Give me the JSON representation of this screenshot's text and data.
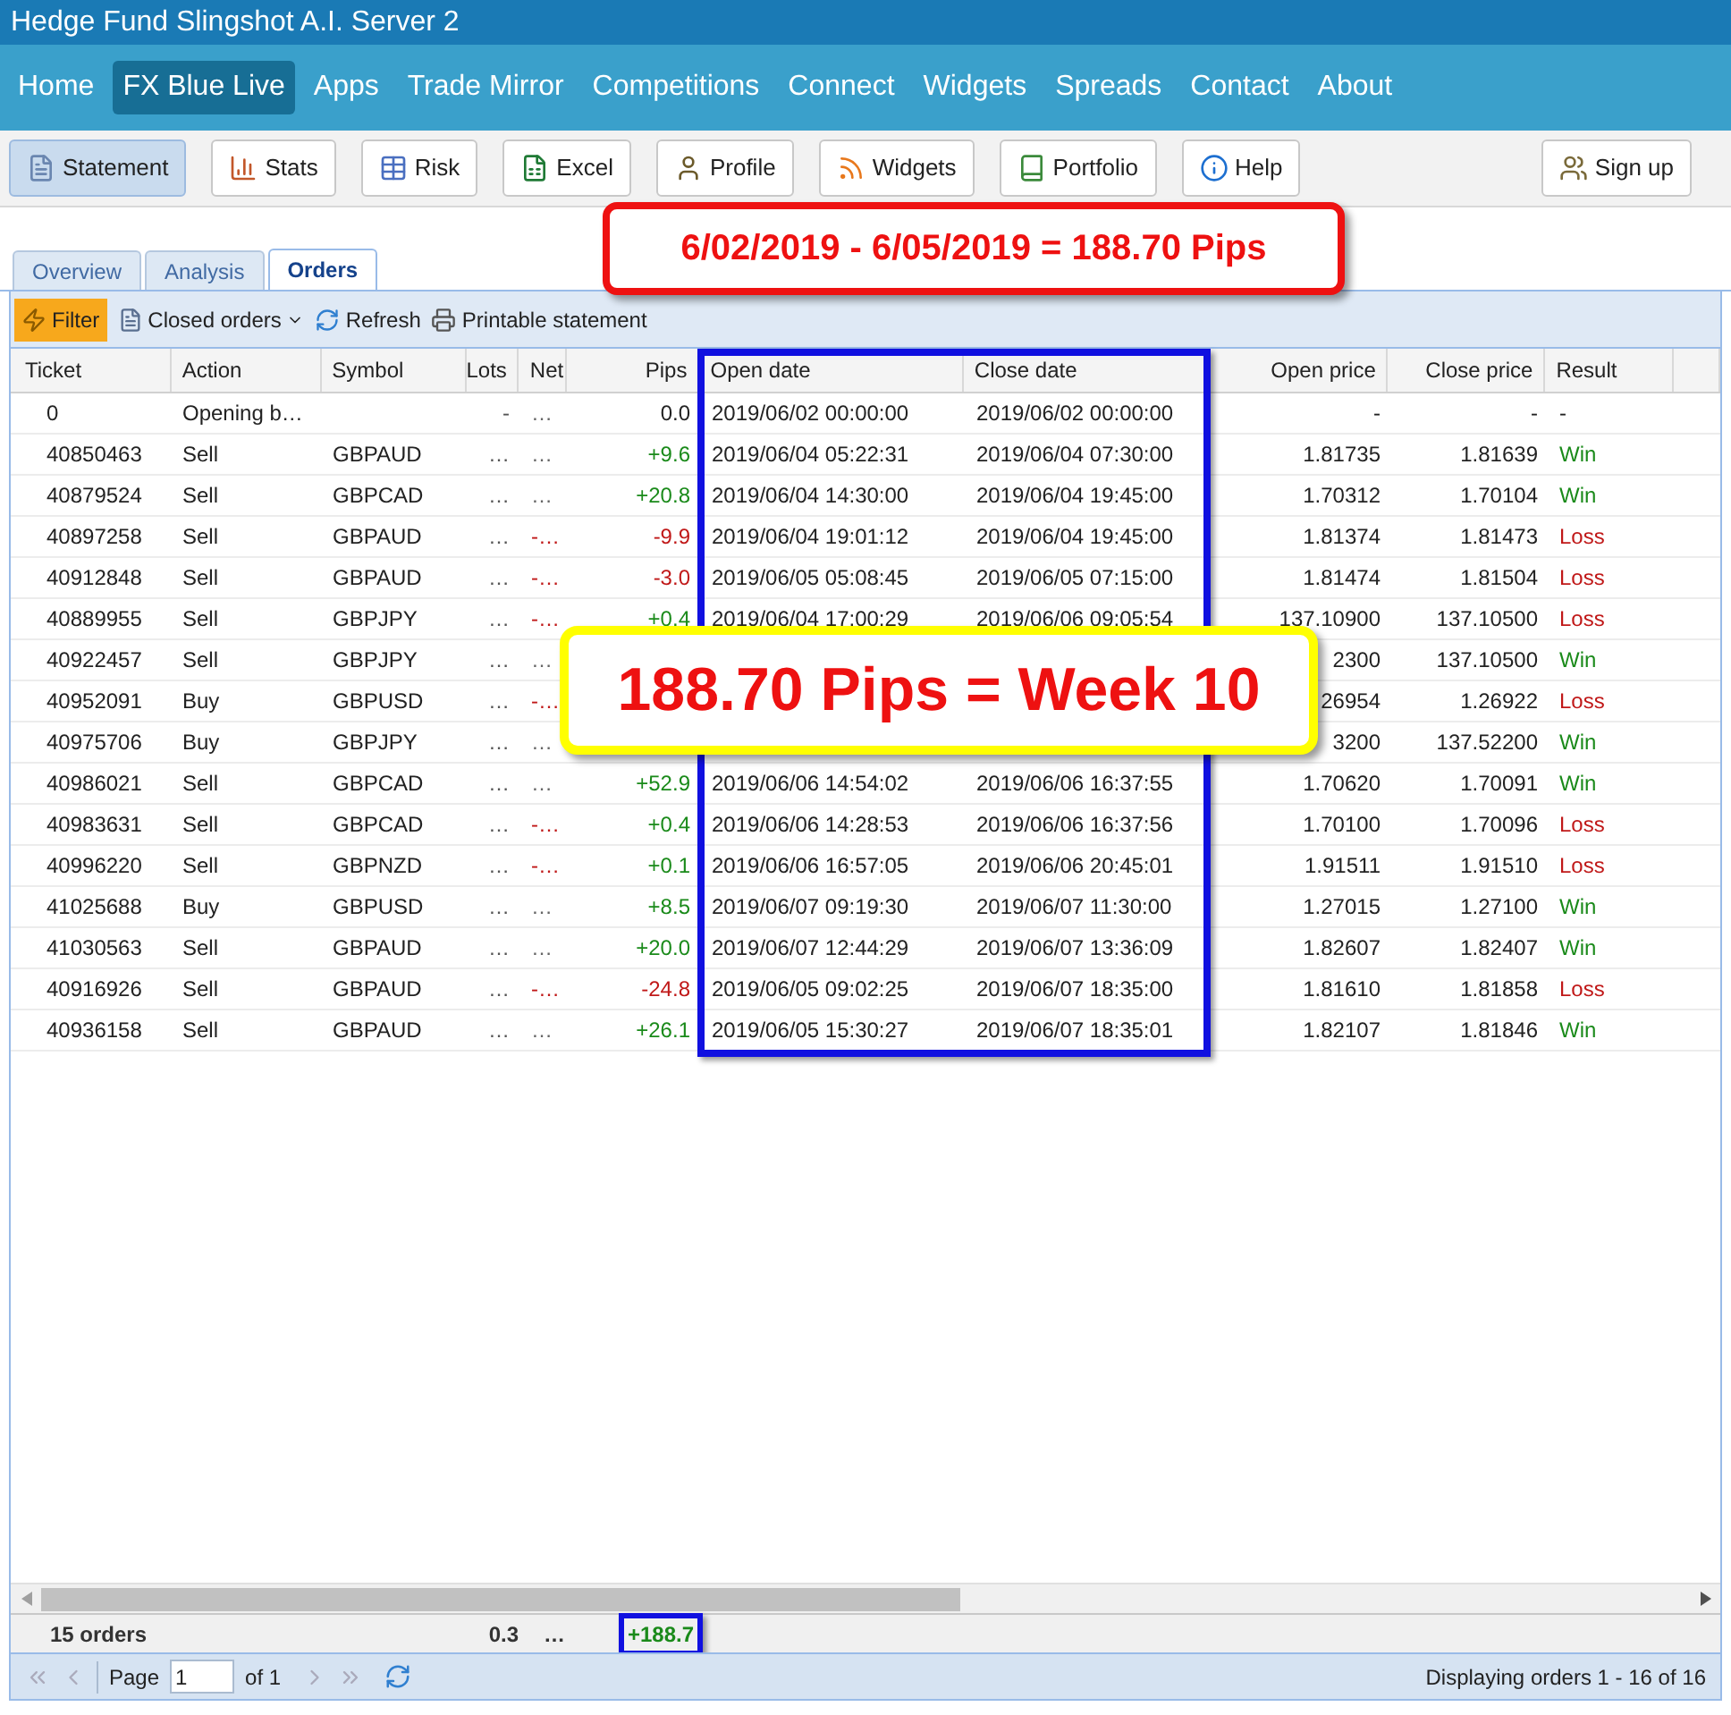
{
  "window": {
    "title": "Hedge Fund Slingshot A.I. Server 2"
  },
  "nav": [
    {
      "label": "Home",
      "selected": false
    },
    {
      "label": "FX Blue Live",
      "selected": true
    },
    {
      "label": "Apps",
      "selected": false
    },
    {
      "label": "Trade Mirror",
      "selected": false
    },
    {
      "label": "Competitions",
      "selected": false
    },
    {
      "label": "Connect",
      "selected": false
    },
    {
      "label": "Widgets",
      "selected": false
    },
    {
      "label": "Spreads",
      "selected": false
    },
    {
      "label": "Contact",
      "selected": false
    },
    {
      "label": "About",
      "selected": false
    }
  ],
  "toolbar": [
    {
      "label": "Statement",
      "selected": true
    },
    {
      "label": "Stats",
      "selected": false
    },
    {
      "label": "Risk",
      "selected": false
    },
    {
      "label": "Excel",
      "selected": false
    },
    {
      "label": "Profile",
      "selected": false
    },
    {
      "label": "Widgets",
      "selected": false
    },
    {
      "label": "Portfolio",
      "selected": false
    },
    {
      "label": "Help",
      "selected": false
    }
  ],
  "sign_up": "Sign up",
  "top_callout": {
    "text": "6/02/2019 - 6/05/2019 = 188.70 Pips"
  },
  "tabs": [
    {
      "label": "Overview",
      "selected": false
    },
    {
      "label": "Analysis",
      "selected": false
    },
    {
      "label": "Orders",
      "selected": true
    }
  ],
  "grid_toolbar": {
    "filter": "Filter",
    "closed_orders": "Closed orders",
    "refresh": "Refresh",
    "printable": "Printable statement"
  },
  "table": {
    "columns": [
      "Ticket",
      "Action",
      "Symbol",
      "Lots",
      "Net",
      "Pips",
      "Open date",
      "Close date",
      "Open price",
      "Close price",
      "Result"
    ],
    "rows": [
      {
        "kind": "opening",
        "ticket": "0",
        "action": "Opening b…",
        "lots": "-",
        "net": "…",
        "net_negative": false,
        "pips": "0.0",
        "open_date": "2019/06/02 00:00:00",
        "close_date": "2019/06/02 00:00:00",
        "open_price": "-",
        "close_price": "-",
        "result": "-"
      },
      {
        "kind": "trade",
        "ticket": "40850463",
        "action": "Sell",
        "symbol": "GBPAUD",
        "lots": "…",
        "net": "…",
        "net_negative": false,
        "pips": "+9.6",
        "gain": true,
        "open_date": "2019/06/04 05:22:31",
        "close_date": "2019/06/04 07:30:00",
        "open_price": "1.81735",
        "close_price": "1.81639",
        "result": "Win",
        "won": true
      },
      {
        "kind": "trade",
        "ticket": "40879524",
        "action": "Sell",
        "symbol": "GBPCAD",
        "lots": "…",
        "net": "…",
        "net_negative": false,
        "pips": "+20.8",
        "gain": true,
        "open_date": "2019/06/04 14:30:00",
        "close_date": "2019/06/04 19:45:00",
        "open_price": "1.70312",
        "close_price": "1.70104",
        "result": "Win",
        "won": true
      },
      {
        "kind": "trade",
        "ticket": "40897258",
        "action": "Sell",
        "symbol": "GBPAUD",
        "lots": "…",
        "net": "-…",
        "net_negative": true,
        "pips": "-9.9",
        "gain": false,
        "open_date": "2019/06/04 19:01:12",
        "close_date": "2019/06/04 19:45:00",
        "open_price": "1.81374",
        "close_price": "1.81473",
        "result": "Loss",
        "won": false
      },
      {
        "kind": "trade",
        "ticket": "40912848",
        "action": "Sell",
        "symbol": "GBPAUD",
        "lots": "…",
        "net": "-…",
        "net_negative": true,
        "pips": "-3.0",
        "gain": false,
        "open_date": "2019/06/05 05:08:45",
        "close_date": "2019/06/05 07:15:00",
        "open_price": "1.81474",
        "close_price": "1.81504",
        "result": "Loss",
        "won": false
      },
      {
        "kind": "trade",
        "ticket": "40889955",
        "action": "Sell",
        "symbol": "GBPJPY",
        "lots": "…",
        "net": "-…",
        "net_negative": true,
        "pips": "+0.4",
        "gain": true,
        "open_date": "2019/06/04 17:00:29",
        "close_date": "2019/06/06 09:05:54",
        "open_price": "137.10900",
        "close_price": "137.10500",
        "result": "Loss",
        "won": false
      },
      {
        "kind": "trade",
        "ticket": "40922457",
        "action": "Sell",
        "symbol": "GBPJPY",
        "lots": "…",
        "net": "…",
        "net_negative": false,
        "open_price": "2300",
        "close_price": "137.10500",
        "result": "Win",
        "won": true
      },
      {
        "kind": "trade",
        "ticket": "40952091",
        "action": "Buy",
        "symbol": "GBPUSD",
        "lots": "…",
        "net": "-…",
        "net_negative": true,
        "open_price": "26954",
        "close_price": "1.26922",
        "result": "Loss",
        "won": false
      },
      {
        "kind": "trade",
        "ticket": "40975706",
        "action": "Buy",
        "symbol": "GBPJPY",
        "lots": "…",
        "net": "…",
        "net_negative": false,
        "open_price": "3200",
        "close_price": "137.52200",
        "result": "Win",
        "won": true
      },
      {
        "kind": "trade",
        "ticket": "40986021",
        "action": "Sell",
        "symbol": "GBPCAD",
        "lots": "…",
        "net": "…",
        "net_negative": false,
        "pips": "+52.9",
        "gain": true,
        "open_date": "2019/06/06 14:54:02",
        "close_date": "2019/06/06 16:37:55",
        "open_price": "1.70620",
        "close_price": "1.70091",
        "result": "Win",
        "won": true
      },
      {
        "kind": "trade",
        "ticket": "40983631",
        "action": "Sell",
        "symbol": "GBPCAD",
        "lots": "…",
        "net": "-…",
        "net_negative": true,
        "pips": "+0.4",
        "gain": true,
        "open_date": "2019/06/06 14:28:53",
        "close_date": "2019/06/06 16:37:56",
        "open_price": "1.70100",
        "close_price": "1.70096",
        "result": "Loss",
        "won": false
      },
      {
        "kind": "trade",
        "ticket": "40996220",
        "action": "Sell",
        "symbol": "GBPNZD",
        "lots": "…",
        "net": "-…",
        "net_negative": true,
        "pips": "+0.1",
        "gain": true,
        "open_date": "2019/06/06 16:57:05",
        "close_date": "2019/06/06 20:45:01",
        "open_price": "1.91511",
        "close_price": "1.91510",
        "result": "Loss",
        "won": false
      },
      {
        "kind": "trade",
        "ticket": "41025688",
        "action": "Buy",
        "symbol": "GBPUSD",
        "lots": "…",
        "net": "…",
        "net_negative": false,
        "pips": "+8.5",
        "gain": true,
        "open_date": "2019/06/07 09:19:30",
        "close_date": "2019/06/07 11:30:00",
        "open_price": "1.27015",
        "close_price": "1.27100",
        "result": "Win",
        "won": true
      },
      {
        "kind": "trade",
        "ticket": "41030563",
        "action": "Sell",
        "symbol": "GBPAUD",
        "lots": "…",
        "net": "…",
        "net_negative": false,
        "pips": "+20.0",
        "gain": true,
        "open_date": "2019/06/07 12:44:29",
        "close_date": "2019/06/07 13:36:09",
        "open_price": "1.82607",
        "close_price": "1.82407",
        "result": "Win",
        "won": true
      },
      {
        "kind": "trade",
        "ticket": "40916926",
        "action": "Sell",
        "symbol": "GBPAUD",
        "lots": "…",
        "net": "-…",
        "net_negative": true,
        "pips": "-24.8",
        "gain": false,
        "open_date": "2019/06/05 09:02:25",
        "close_date": "2019/06/07 18:35:00",
        "open_price": "1.81610",
        "close_price": "1.81858",
        "result": "Loss",
        "won": false
      },
      {
        "kind": "trade",
        "ticket": "40936158",
        "action": "Sell",
        "symbol": "GBPAUD",
        "lots": "…",
        "net": "…",
        "net_negative": false,
        "pips": "+26.1",
        "gain": true,
        "open_date": "2019/06/05 15:30:27",
        "close_date": "2019/06/07 18:35:01",
        "open_price": "1.82107",
        "close_price": "1.81846",
        "result": "Win",
        "won": true
      }
    ]
  },
  "middle_callout": {
    "text": "188.70 Pips = Week 10"
  },
  "summary": {
    "count": "15 orders",
    "lots": "0.3",
    "net": "…",
    "pips": "+188.7"
  },
  "pager": {
    "page_label": "Page",
    "page": "1",
    "of": "of 1",
    "display": "Displaying orders 1 - 16 of 16"
  }
}
